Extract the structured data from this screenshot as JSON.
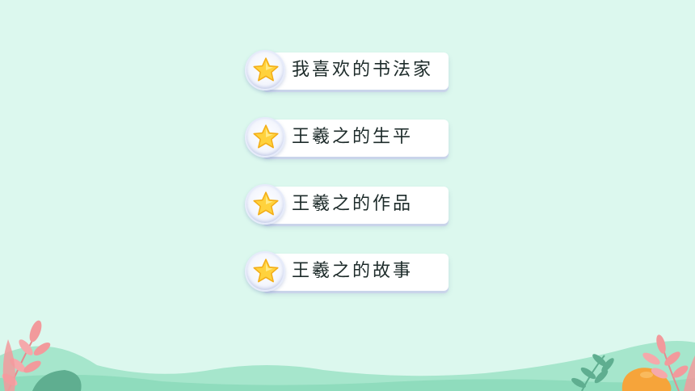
{
  "menu": {
    "items": [
      {
        "label": "我喜欢的书法家",
        "icon": "star-icon"
      },
      {
        "label": "王羲之的生平",
        "icon": "star-icon"
      },
      {
        "label": "王羲之的作品",
        "icon": "star-icon"
      },
      {
        "label": "王羲之的故事",
        "icon": "star-icon"
      }
    ]
  },
  "colors": {
    "background": "#dcf8ee",
    "hills": "#a6e6cc",
    "leaf_pink": "#f29a9c",
    "leaf_green": "#5fae90",
    "orange_fruit": "#f6a43a",
    "star": "#ffd23d"
  }
}
